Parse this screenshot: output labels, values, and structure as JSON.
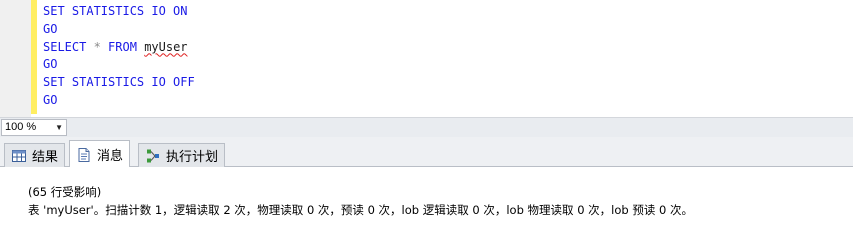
{
  "editor": {
    "lines": [
      {
        "keyword": "SET STATISTICS IO ON"
      },
      {
        "keyword": "GO"
      },
      {
        "keyword": "SELECT",
        "op": " * ",
        "keyword2": "FROM",
        "ident": "myUser"
      },
      {
        "keyword": "GO"
      },
      {
        "keyword": "SET STATISTICS IO OFF"
      },
      {
        "keyword": "GO"
      }
    ]
  },
  "zoom": {
    "value": "100 %"
  },
  "tabs": [
    {
      "label": "结果",
      "icon": "grid-icon",
      "active": false
    },
    {
      "label": "消息",
      "icon": "message-icon",
      "active": true
    },
    {
      "label": "执行计划",
      "icon": "execution-plan-icon",
      "active": false
    }
  ],
  "messages": {
    "line1": "(65 行受影响)",
    "line2": "表 'myUser'。扫描计数 1，逻辑读取 2 次，物理读取 0 次，预读 0 次，lob 逻辑读取 0 次，lob 物理读取 0 次，lob 预读 0 次。"
  },
  "colors": {
    "keyword": "#1a1ae6",
    "change_bar": "#ffee62",
    "squiggle": "#e02020"
  }
}
